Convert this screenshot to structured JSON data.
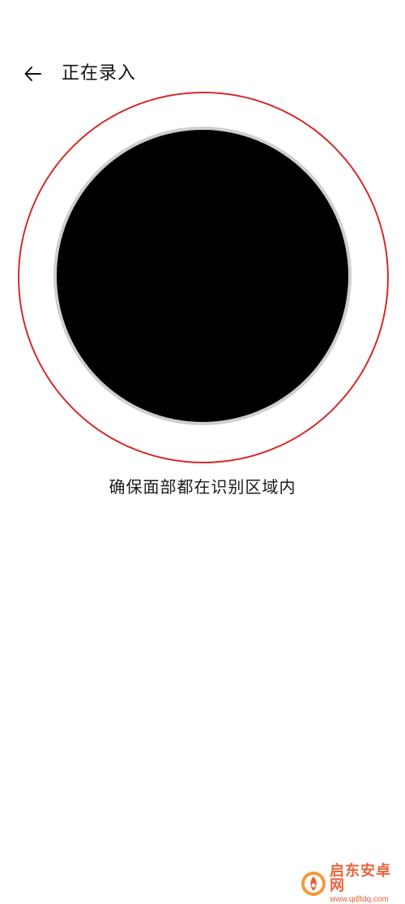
{
  "header": {
    "back_icon": "arrow-left-icon",
    "title": "正在录入"
  },
  "face_enroll": {
    "ring_color": "#d42a2a",
    "gray_ring_color": "#cfcfcf",
    "preview_color": "#000000",
    "hint": "确保面部都在识别区域内"
  },
  "watermark": {
    "logo_icon": "qidian-logo-icon",
    "name": "启东安卓网",
    "url": "www.qdltdq.com",
    "color": "#e8643c"
  }
}
